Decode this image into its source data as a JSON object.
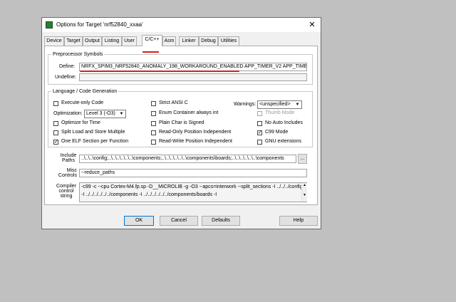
{
  "dialog": {
    "title": "Options for Target 'nrf52840_xxaa'",
    "close_glyph": "✕"
  },
  "tabs": [
    {
      "label": "Device"
    },
    {
      "label": "Target"
    },
    {
      "label": "Output"
    },
    {
      "label": "Listing"
    },
    {
      "label": "User"
    },
    {
      "label": "C/C++"
    },
    {
      "label": "Asm"
    },
    {
      "label": "Linker"
    },
    {
      "label": "Debug"
    },
    {
      "label": "Utilities"
    }
  ],
  "preprocessor": {
    "group_label": "Preprocessor Symbols",
    "define_label": "Define:",
    "define_value": "NRFX_SPIM3_NRF52840_ANOMALY_198_WORKAROUND_ENABLED APP_TIMER_V2 APP_TIMER",
    "undefine_label": "Undefine:",
    "undefine_value": ""
  },
  "codegen": {
    "group_label": "Language / Code Generation",
    "execute_only": {
      "label": "Execute-only Code",
      "checked": false
    },
    "optimization_label": "Optimization:",
    "optimization_value": "Level 3 (-O3)",
    "optimize_time": {
      "label": "Optimize for Time",
      "checked": false
    },
    "split_load": {
      "label": "Split Load and Store Multiple",
      "checked": false
    },
    "one_elf": {
      "label": "One ELF Section per Function",
      "checked": true
    },
    "strict_ansi": {
      "label": "Strict ANSI C",
      "checked": false
    },
    "enum_container": {
      "label": "Enum Container always int",
      "checked": false
    },
    "plain_char": {
      "label": "Plain Char is Signed",
      "checked": false
    },
    "ro_pi": {
      "label": "Read-Only Position Independent",
      "checked": false
    },
    "rw_pi": {
      "label": "Read-Write Position Independent",
      "checked": false
    },
    "warnings_label": "Warnings:",
    "warnings_value": "<unspecified>",
    "thumb_mode": {
      "label": "Thumb Mode",
      "checked": false,
      "enabled": false
    },
    "no_auto_includes": {
      "label": "No Auto Includes",
      "checked": false
    },
    "c99_mode": {
      "label": "C99 Mode",
      "checked": true
    },
    "gnu_ext": {
      "label": "GNU extensions",
      "checked": false
    }
  },
  "include_paths": {
    "label_line1": "Include",
    "label_line2": "Paths",
    "value": "..\\..\\..\\config;..\\..\\..\\..\\..\\..\\components;..\\..\\..\\..\\..\\..\\components\\boards;..\\..\\..\\..\\..\\..\\components",
    "browse_label": "..."
  },
  "misc_controls": {
    "label_line1": "Misc",
    "label_line2": "Controls",
    "value": "--reduce_paths"
  },
  "compiler_control": {
    "label_line1": "Compiler",
    "label_line2": "control",
    "label_line3": "string",
    "line1": "-c99 -c --cpu Cortex-M4.fp.sp -D__MICROLIB -g -O3 --apcs=interwork --split_sections -I ../../../config",
    "line2": "-I ../../../../../../components -I ../../../../../../components/boards -I"
  },
  "buttons": {
    "ok": "OK",
    "cancel": "Cancel",
    "defaults": "Defaults",
    "help": "Help"
  },
  "scroll": {
    "up": "▲",
    "down": "▼"
  },
  "annotation_color": "#d32020"
}
